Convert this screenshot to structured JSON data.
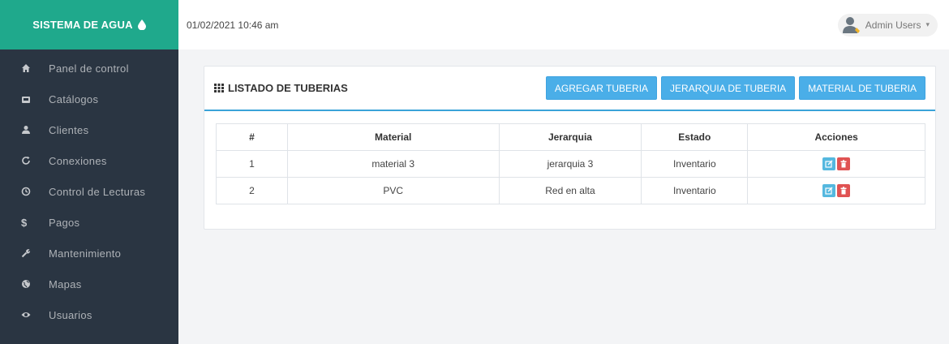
{
  "brand": {
    "title": "SISTEMA DE AGUA"
  },
  "sidebar": {
    "items": [
      {
        "label": "Panel de control",
        "icon": "home-icon"
      },
      {
        "label": "Catálogos",
        "icon": "folder-icon"
      },
      {
        "label": "Clientes",
        "icon": "user-icon"
      },
      {
        "label": "Conexiones",
        "icon": "refresh-icon"
      },
      {
        "label": "Control de Lecturas",
        "icon": "clock-icon"
      },
      {
        "label": "Pagos",
        "icon": "dollar-icon"
      },
      {
        "label": "Mantenimiento",
        "icon": "wrench-icon"
      },
      {
        "label": "Mapas",
        "icon": "globe-icon"
      },
      {
        "label": "Usuarios",
        "icon": "eye-icon"
      }
    ]
  },
  "header": {
    "datetime": "01/02/2021 10:46 am",
    "user": "Admin Users"
  },
  "panel": {
    "title": "LISTADO DE TUBERIAS",
    "buttons": {
      "add": "AGREGAR TUBERIA",
      "hierarchy": "JERARQUIA DE TUBERIA",
      "material": "MATERIAL DE TUBERIA"
    }
  },
  "table": {
    "headers": [
      "#",
      "Material",
      "Jerarquia",
      "Estado",
      "Acciones"
    ],
    "rows": [
      [
        "1",
        "material 3",
        "jerarquia 3",
        "Inventario"
      ],
      [
        "2",
        "PVC",
        "Red en alta",
        "Inventario"
      ]
    ]
  },
  "colors": {
    "brand": "#1fa98c",
    "sidebar": "#2a3542",
    "button": "#4aaee8",
    "edit": "#55b8df",
    "delete": "#e05353"
  }
}
